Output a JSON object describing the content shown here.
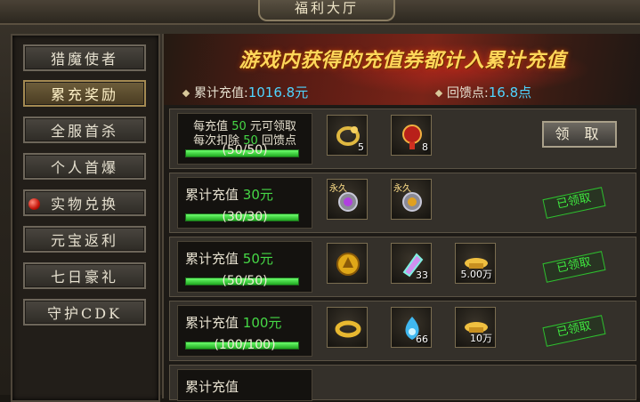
{
  "window": {
    "title": "福利大厅"
  },
  "sidebar": {
    "items": [
      {
        "label": "猎魔使者",
        "active": false
      },
      {
        "label": "累充奖励",
        "active": true
      },
      {
        "label": "全服首杀",
        "active": false
      },
      {
        "label": "个人首爆",
        "active": false
      },
      {
        "label": "实物兑换",
        "active": false,
        "badge": "red-dot"
      },
      {
        "label": "元宝返利",
        "active": false
      },
      {
        "label": "七日豪礼",
        "active": false
      },
      {
        "label": "守护CDK",
        "active": false
      }
    ]
  },
  "banner": {
    "headline": "游戏内获得的充值券都计入累计充值",
    "cumulative_label": "累计充值:",
    "cumulative_value": "1016.8元",
    "points_label": "回馈点:",
    "points_value": "16.8点"
  },
  "rows": [
    {
      "line1_a": "每充值",
      "line1_num": "50",
      "line1_b": "元可领取",
      "line2_a": "每次扣除",
      "line2_num": "50",
      "line2_b": "回馈点",
      "progress_text": "(50/50)",
      "progress": 1.0,
      "items": [
        {
          "icon": "dragon-bracelet-icon",
          "count": "5"
        },
        {
          "icon": "red-gem-pouch-icon",
          "count": "8"
        }
      ],
      "action": "领 取"
    },
    {
      "label": "累计充值",
      "amount": "30元",
      "progress_text": "(30/30)",
      "progress": 1.0,
      "items": [
        {
          "icon": "purple-orb-icon",
          "tag": "永久",
          "count": ""
        },
        {
          "icon": "gold-orb-icon",
          "tag": "永久",
          "count": ""
        }
      ],
      "status": "已领取"
    },
    {
      "label": "累计充值",
      "amount": "50元",
      "progress_text": "(50/50)",
      "progress": 1.0,
      "items": [
        {
          "icon": "gold-medallion-icon",
          "count": ""
        },
        {
          "icon": "crystal-shard-icon",
          "count": "33"
        },
        {
          "icon": "gold-ingot-icon",
          "count": "5.00万"
        }
      ],
      "status": "已领取"
    },
    {
      "label": "累计充值",
      "amount": "100元",
      "progress_text": "(100/100)",
      "progress": 1.0,
      "items": [
        {
          "icon": "gold-ring-icon",
          "count": ""
        },
        {
          "icon": "blue-flame-icon",
          "count": "66"
        },
        {
          "icon": "gold-ingot-icon",
          "count": "10万"
        }
      ],
      "status": "已领取"
    }
  ],
  "partial_row": {
    "label": "累计充值"
  }
}
